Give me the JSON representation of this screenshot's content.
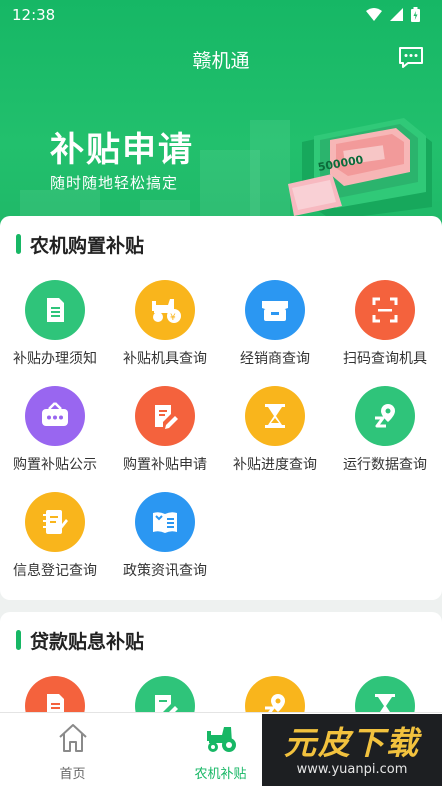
{
  "status": {
    "time": "12:38"
  },
  "header": {
    "title": "赣机通",
    "message_icon": "message-icon"
  },
  "banner": {
    "title": "补贴申请",
    "subtitle": "随时随地轻松搞定",
    "amount": "500000"
  },
  "sections": [
    {
      "title": "农机购置补贴",
      "items": [
        {
          "label": "补贴办理须知",
          "icon": "document-icon",
          "color": "#2fc47a"
        },
        {
          "label": "补贴机具查询",
          "icon": "tractor-icon",
          "color": "#f9b51c"
        },
        {
          "label": "经销商查询",
          "icon": "store-icon",
          "color": "#2b97f2"
        },
        {
          "label": "扫码查询机具",
          "icon": "scan-icon",
          "color": "#f4623d"
        },
        {
          "label": "购置补贴公示",
          "icon": "notice-board-icon",
          "color": "#9966f0"
        },
        {
          "label": "购置补贴申请",
          "icon": "edit-form-icon",
          "color": "#f4623d"
        },
        {
          "label": "补贴进度查询",
          "icon": "hourglass-icon",
          "color": "#f9b51c"
        },
        {
          "label": "运行数据查询",
          "icon": "location-route-icon",
          "color": "#2fc47a"
        },
        {
          "label": "信息登记查询",
          "icon": "notebook-icon",
          "color": "#f9b51c"
        },
        {
          "label": "政策资讯查询",
          "icon": "book-icon",
          "color": "#2b97f2"
        }
      ]
    },
    {
      "title": "贷款贴息补贴",
      "items": [
        {
          "icon": "document-icon",
          "color": "#f4623d"
        },
        {
          "icon": "edit-form-icon",
          "color": "#2fc47a"
        },
        {
          "icon": "location-route-icon",
          "color": "#f9b51c"
        },
        {
          "icon": "hourglass-icon",
          "color": "#2fc47a"
        }
      ]
    }
  ],
  "tabs": [
    {
      "label": "首页",
      "icon": "home-icon",
      "active": false
    },
    {
      "label": "农机补贴",
      "icon": "tractor-icon",
      "active": true
    }
  ],
  "watermark": {
    "text": "元皮下载",
    "url": "www.yuanpi.com"
  },
  "colors": {
    "primary": "#17b765",
    "tab_inactive": "#666666"
  }
}
